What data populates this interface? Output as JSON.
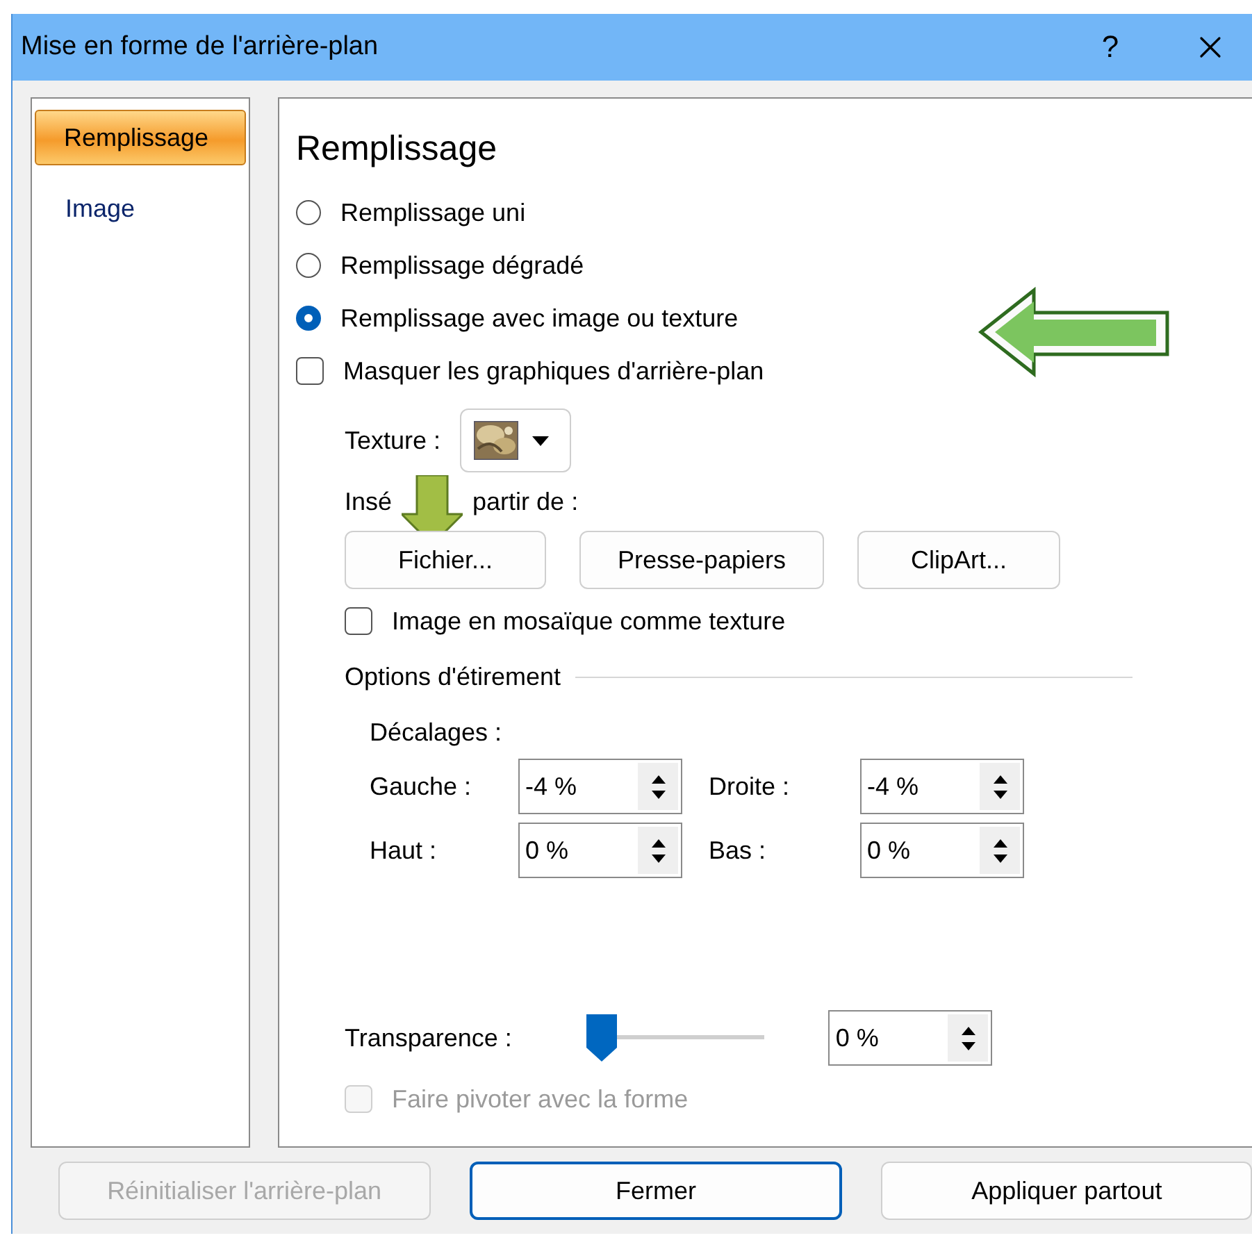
{
  "window": {
    "title": "Mise en forme de l'arrière-plan",
    "help": "?"
  },
  "sidebar": {
    "items": [
      {
        "label": "Remplissage",
        "selected": true
      },
      {
        "label": "Image",
        "selected": false
      }
    ]
  },
  "panel": {
    "heading": "Remplissage",
    "fill_types": [
      {
        "label": "Remplissage uni",
        "selected": false
      },
      {
        "label": "Remplissage dégradé",
        "selected": false
      },
      {
        "label": "Remplissage avec image ou texture",
        "selected": true
      }
    ],
    "hide_graphics": {
      "label": "Masquer les graphiques d'arrière-plan",
      "checked": false
    },
    "texture": {
      "label": "Texture :"
    },
    "insert_from": {
      "label_parts": [
        "Insé",
        "partir de :"
      ],
      "buttons": [
        "Fichier...",
        "Presse-papiers",
        "ClipArt..."
      ]
    },
    "tile": {
      "label": "Image en mosaïque comme texture",
      "checked": false
    },
    "stretch": {
      "title": "Options d'étirement",
      "offsets_label": "Décalages :",
      "fields": [
        {
          "label": "Gauche :",
          "value": "-4 %"
        },
        {
          "label": "Droite :",
          "value": "-4 %"
        },
        {
          "label": "Haut :",
          "value": "0 %"
        },
        {
          "label": "Bas :",
          "value": "0 %"
        }
      ]
    },
    "transparency": {
      "label": "Transparence :",
      "level": 0,
      "value": "0 %"
    },
    "rotate": {
      "label": "Faire pivoter avec la forme",
      "checked": false,
      "disabled": true
    }
  },
  "footer": {
    "buttons": [
      {
        "label": "Réinitialiser l'arrière-plan",
        "disabled": true,
        "default": false
      },
      {
        "label": "Fermer",
        "disabled": false,
        "default": true
      },
      {
        "label": "Appliquer partout",
        "disabled": false,
        "default": false
      }
    ]
  }
}
